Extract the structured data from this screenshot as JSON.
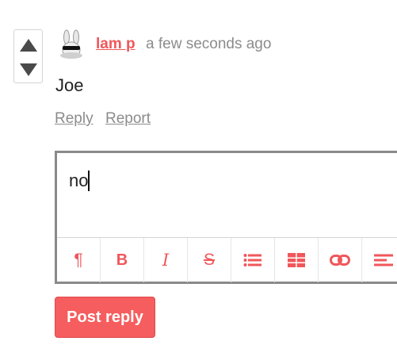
{
  "comment": {
    "author": "lam p",
    "timestamp": "a few seconds ago",
    "body": "Joe",
    "actions": {
      "reply": "Reply",
      "report": "Report"
    }
  },
  "editor": {
    "text": "no",
    "toolbar": [
      "paragraph-icon",
      "bold-icon",
      "italic-icon",
      "strikethrough-icon",
      "bulleted-list-icon",
      "table-icon",
      "link-icon",
      "align-icon"
    ],
    "labels": {
      "bold": "B",
      "italic": "I",
      "strike": "S",
      "paragraph": "¶"
    }
  },
  "post_button": {
    "label": "Post reply"
  },
  "colors": {
    "accent": "#f0575b",
    "muted": "#8c8c8c",
    "border": "#8a8a8a"
  }
}
